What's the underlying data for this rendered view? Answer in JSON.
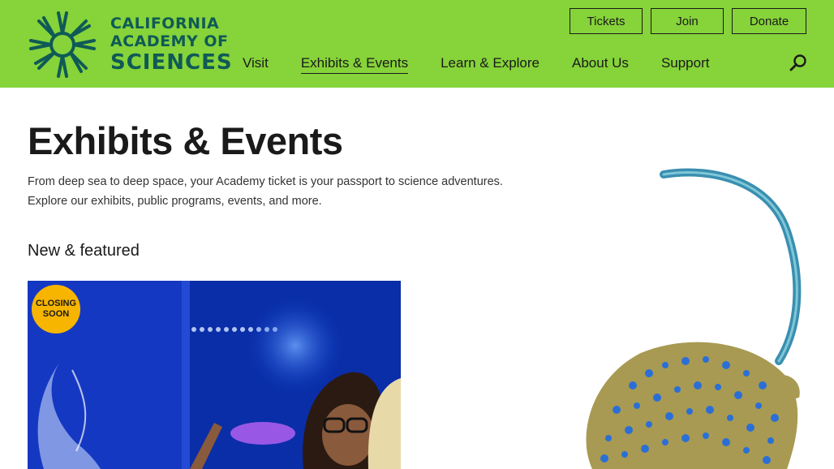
{
  "header": {
    "logo": {
      "line1": "CALIFORNIA",
      "line2": "ACADEMY OF",
      "line3": "SCIENCES",
      "icon": "starburst-logo-icon"
    },
    "top_buttons": {
      "tickets": "Tickets",
      "join": "Join",
      "donate": "Donate"
    },
    "nav": [
      {
        "label": "Visit",
        "active": false
      },
      {
        "label": "Exhibits & Events",
        "active": true
      },
      {
        "label": "Learn & Explore",
        "active": false
      },
      {
        "label": "About Us",
        "active": false
      },
      {
        "label": "Support",
        "active": false
      }
    ],
    "search_icon": "search-icon"
  },
  "main": {
    "title": "Exhibits & Events",
    "intro_line1": "From deep sea to deep space, your Academy ticket is your passport to science adventures.",
    "intro_line2": "Explore our exhibits, public programs, events, and more.",
    "section_heading": "New & featured",
    "featured_card": {
      "badge_line1": "CLOSING",
      "badge_line2": "SOON"
    }
  },
  "colors": {
    "header_bg": "#86d33a",
    "logo": "#0f5a56",
    "badge": "#f7b500",
    "card_blue": "#0b3fd0"
  }
}
